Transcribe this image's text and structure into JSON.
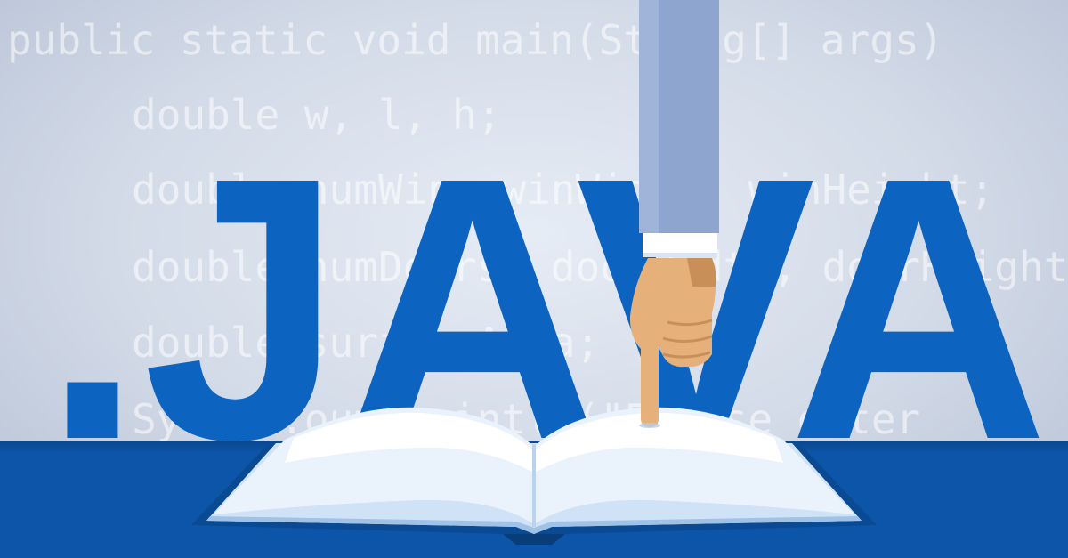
{
  "code_lines": [
    "public static void main(String[] args)",
    "double w, l, h;",
    "double numWin, winWidth, winHeight;",
    "double numDoors, doorWidth, doorHeight;",
    "double surfaceArea;",
    "System.out.println(\"Please enter"
  ],
  "headline": ".JAVA",
  "colors": {
    "headline": "#0c64c0",
    "floor": "#0c55a8",
    "sleeve": "#8ea6cf",
    "skin": "#e6b07a",
    "cuff": "#ffffff",
    "book_pages": "#e6f1fb",
    "book_cover": "#0a4a92"
  },
  "icons": [
    "open-book-illustration",
    "pointing-hand-illustration"
  ]
}
